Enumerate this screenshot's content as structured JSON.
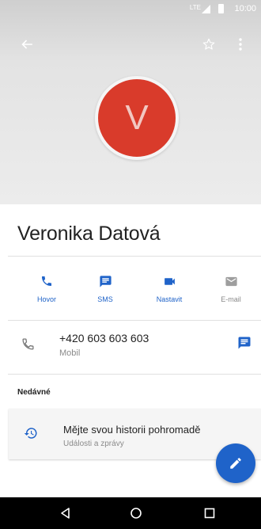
{
  "status_bar": {
    "network": "LTE",
    "time": "10:00"
  },
  "contact": {
    "initial": "V",
    "name": "Veronika Datová",
    "avatar_color": "#d93b2b"
  },
  "actions": [
    {
      "label": "Hovor",
      "icon": "phone-icon"
    },
    {
      "label": "SMS",
      "icon": "message-icon"
    },
    {
      "label": "Nastavit",
      "icon": "video-icon"
    },
    {
      "label": "E-mail",
      "icon": "email-icon"
    }
  ],
  "phone": {
    "number": "+420 603 603 603",
    "type": "Mobil"
  },
  "recent": {
    "title": "Nedávné",
    "card_title": "Mějte svou historii pohromadě",
    "card_subtitle": "Události a zprávy"
  },
  "colors": {
    "accent": "#1f63c9",
    "muted": "#8a8a8a"
  }
}
